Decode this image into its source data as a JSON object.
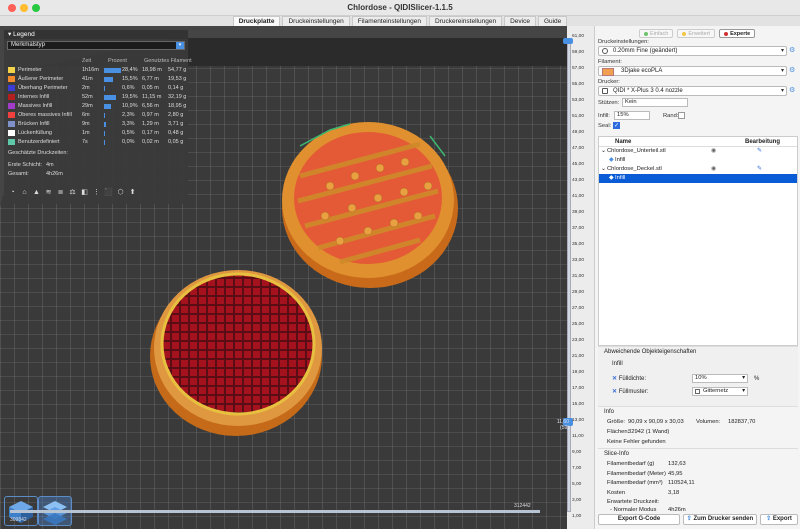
{
  "window": {
    "title": "Chlordose - QIDISlicer-1.1.5"
  },
  "tabs": [
    "Druckplatte",
    "Druckeinstellungen",
    "Filamenteinstellungen",
    "Druckereinstellungen",
    "Device",
    "Guide"
  ],
  "legend": {
    "title": "Legend",
    "view_type": "Merkmalstyp",
    "headers": {
      "time": "Zeit",
      "percent": "Prozent",
      "filament": "Genutztes Filament"
    },
    "rows": [
      {
        "name": "Perimeter",
        "time": "1h16m",
        "pct": "28,4%",
        "len": "18,98 m",
        "wt": "54,77 g",
        "color": "#f2d34a",
        "bar": 0.284
      },
      {
        "name": "Äußerer Perimeter",
        "time": "41m",
        "pct": "15,5%",
        "len": "6,77 m",
        "wt": "19,53 g",
        "color": "#f08a2a",
        "bar": 0.155
      },
      {
        "name": "Überhang Perimeter",
        "time": "2m",
        "pct": "0,6%",
        "len": "0,05 m",
        "wt": "0,14 g",
        "color": "#3b3bd6",
        "bar": 0.006
      },
      {
        "name": "Internes Infill",
        "time": "52m",
        "pct": "19,5%",
        "len": "11,15 m",
        "wt": "32,19 g",
        "color": "#b31f1f",
        "bar": 0.195
      },
      {
        "name": "Massives Infill",
        "time": "29m",
        "pct": "10,9%",
        "len": "6,56 m",
        "wt": "18,95 g",
        "color": "#a03cc8",
        "bar": 0.109
      },
      {
        "name": "Oberes massives Infill",
        "time": "6m",
        "pct": "2,3%",
        "len": "0,97 m",
        "wt": "2,80 g",
        "color": "#f04040",
        "bar": 0.023
      },
      {
        "name": "Brücken Infill",
        "time": "9m",
        "pct": "3,3%",
        "len": "1,29 m",
        "wt": "3,71 g",
        "color": "#8090c8",
        "bar": 0.033
      },
      {
        "name": "Lückenfüllung",
        "time": "1m",
        "pct": "0,5%",
        "len": "0,17 m",
        "wt": "0,48 g",
        "color": "#ffffff",
        "bar": 0.005
      },
      {
        "name": "Benutzerdefiniert",
        "time": "7s",
        "pct": "0,0%",
        "len": "0,02 m",
        "wt": "0,05 g",
        "color": "#5ec8a8",
        "bar": 0.0
      }
    ],
    "estimated_label": "Geschätzte Druckzeiten:",
    "first_layer": "Erste Schicht:",
    "first_layer_val": "4m",
    "total": "Gesamt:",
    "total_val": "4h26m"
  },
  "slider": {
    "ticks": [
      "61,00",
      "59,00",
      "57,00",
      "55,00",
      "53,00",
      "51,00",
      "49,00",
      "47,00",
      "45,00",
      "43,00",
      "41,00",
      "39,00",
      "37,00",
      "35,00",
      "33,00",
      "31,00",
      "29,00",
      "27,00",
      "25,00",
      "23,00",
      "21,00",
      "19,00",
      "17,00",
      "15,00",
      "13,00",
      "11,00",
      "9,00",
      "7,00",
      "5,00",
      "3,00",
      "1,00"
    ],
    "top_value": "61,00",
    "current_label": "11,60\n(59)",
    "h_left": "309842",
    "h_right": "312442"
  },
  "sidebar": {
    "modes": [
      "Einfach",
      "Erweitert",
      "Experte"
    ],
    "mode_colors": [
      "#6dc36d",
      "#f2c744",
      "#d03030"
    ],
    "print_settings_label": "Druckeinstellungen:",
    "print_settings_value": "0.20mm Fine (geändert)",
    "filament_label": "Filament:",
    "filament_value": "3Djake ecoPLA",
    "filament_color": "#f0a050",
    "printer_label": "Drucker:",
    "printer_value": "QIDI * X-Plus 3 0.4 nozzle",
    "supports_label": "Stützen:",
    "supports_value": "Kein",
    "infill_label": "Infill:",
    "infill_value": "15%",
    "brim_label": "Rand:",
    "seal_label": "Seal:",
    "objects": {
      "col_name": "Name",
      "col_edit": "Bearbeitung",
      "rows": [
        {
          "name": "Chlordose_Unterteil.stl",
          "level": 0,
          "selected": false
        },
        {
          "name": "Infill",
          "level": 1,
          "selected": false
        },
        {
          "name": "Chlordose_Deckel.stl",
          "level": 0,
          "selected": false
        },
        {
          "name": "Infill",
          "level": 1,
          "selected": true
        }
      ]
    },
    "diff_props_title": "Abweichende Objekteigenschaften",
    "infill_section": "Infill",
    "density_label": "Fülldichte:",
    "density_value": "10%",
    "density_unit": "%",
    "pattern_label": "Füllmuster:",
    "pattern_value": "Gitternetz",
    "info_title": "Info",
    "size_label": "Größe:",
    "size_value": "90,09 x 90,09 x 30,03",
    "volume_label": "Volumen:",
    "volume_value": "182837,70",
    "faces_label": "Flächen:",
    "faces_value": "32942 (1 Wand)",
    "errors_value": "Keine Fehler gefunden",
    "slice_info_title": "Slice-Info",
    "slice": [
      {
        "label": "Filamentbedarf (g)",
        "value": "132,63"
      },
      {
        "label": "Filamentbedarf (Meter)",
        "value": "45,95"
      },
      {
        "label": "Filamentbedarf (mm³)",
        "value": "110524,11"
      },
      {
        "label": "Kosten",
        "value": "3,18"
      }
    ],
    "est_time_label": "Erwartete Druckzeit:",
    "normal_mode_label": "- Normaler Modus",
    "normal_mode_value": "4h26m",
    "btn_export_gcode": "Export G-Code",
    "btn_send": "Zum Drucker senden",
    "btn_export": "Export"
  }
}
